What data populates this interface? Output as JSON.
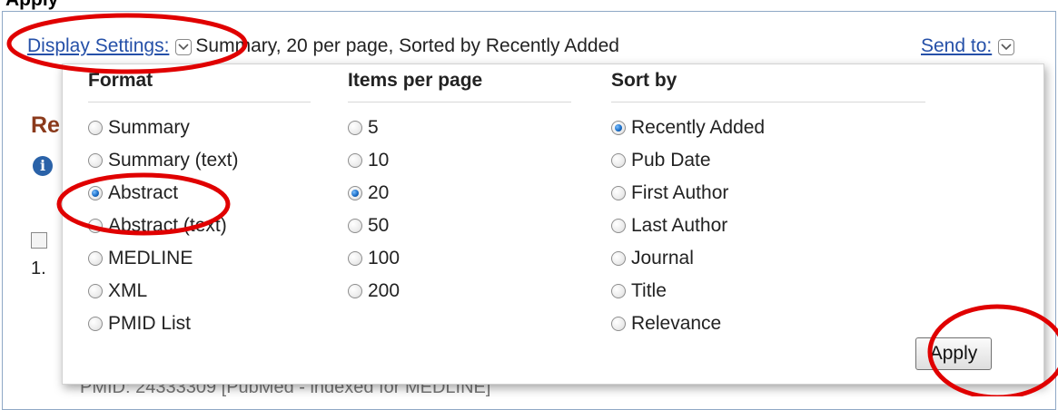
{
  "page": {
    "top_heading": "Apply",
    "bg_heading": "Re",
    "bg_info_glyph": "i",
    "bg_result_number": "1.",
    "bg_pmid_text": "PMID: 24333309 [PubMed - indexed for MEDLINE]"
  },
  "display_settings": {
    "link_label": "Display Settings:",
    "summary": "Summary, 20 per page, Sorted by Recently Added",
    "send_to_label": "Send to:"
  },
  "popup": {
    "format": {
      "header": "Format",
      "options": [
        "Summary",
        "Summary (text)",
        "Abstract",
        "Abstract (text)",
        "MEDLINE",
        "XML",
        "PMID List"
      ],
      "selected": "Abstract"
    },
    "items_per_page": {
      "header": "Items per page",
      "options": [
        "5",
        "10",
        "20",
        "50",
        "100",
        "200"
      ],
      "selected": "20"
    },
    "sort_by": {
      "header": "Sort by",
      "options": [
        "Recently Added",
        "Pub Date",
        "First Author",
        "Last Author",
        "Journal",
        "Title",
        "Relevance"
      ],
      "selected": "Recently Added"
    },
    "apply_label": "Apply"
  },
  "colors": {
    "link": "#2550a8",
    "annotation_red": "#e00000",
    "heading_brown": "#8b3a1b",
    "radio_selected": "#1c6fc8"
  }
}
